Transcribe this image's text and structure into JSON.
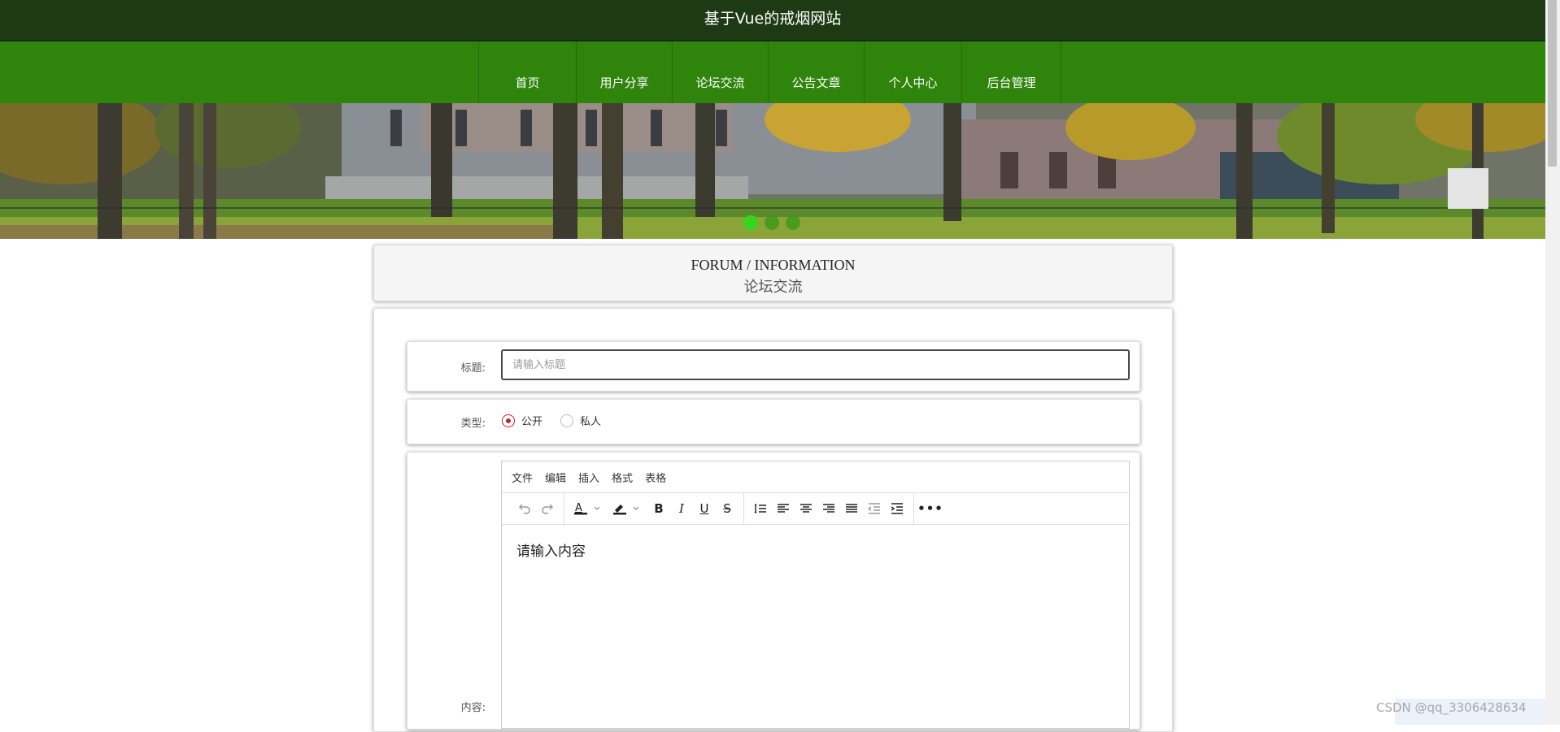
{
  "header": {
    "site_title": "基于Vue的戒烟网站"
  },
  "nav": {
    "items": [
      {
        "label": "首页"
      },
      {
        "label": "用户分享"
      },
      {
        "label": "论坛交流"
      },
      {
        "label": "公告文章"
      },
      {
        "label": "个人中心"
      },
      {
        "label": "后台管理"
      }
    ]
  },
  "banner": {
    "slides": 3,
    "active_slide": 1
  },
  "page_heading": {
    "english": "FORUM / INFORMATION",
    "chinese": "论坛交流"
  },
  "form": {
    "title_label": "标题:",
    "title_placeholder": "请输入标题",
    "type_label": "类型:",
    "type_options": [
      {
        "label": "公开",
        "checked": true
      },
      {
        "label": "私人",
        "checked": false
      }
    ],
    "content_label": "内容:",
    "editor": {
      "menu": [
        "文件",
        "编辑",
        "插入",
        "格式",
        "表格"
      ],
      "placeholder": "请输入内容",
      "toolbar_icons": [
        "undo-icon",
        "redo-icon",
        "text-color-icon",
        "highlight-color-icon",
        "bold-icon",
        "italic-icon",
        "underline-icon",
        "strikethrough-icon",
        "line-height-icon",
        "align-left-icon",
        "align-center-icon",
        "align-right-icon",
        "align-justify-icon",
        "outdent-icon",
        "indent-icon",
        "more-icon"
      ]
    }
  },
  "watermark": "CSDN @qq_3306428634",
  "colors": {
    "top_bar": "#1e3a14",
    "nav_bar": "#2f840c",
    "radio_checked": "#c4232d",
    "carousel_dot_active": "#36d51b"
  }
}
